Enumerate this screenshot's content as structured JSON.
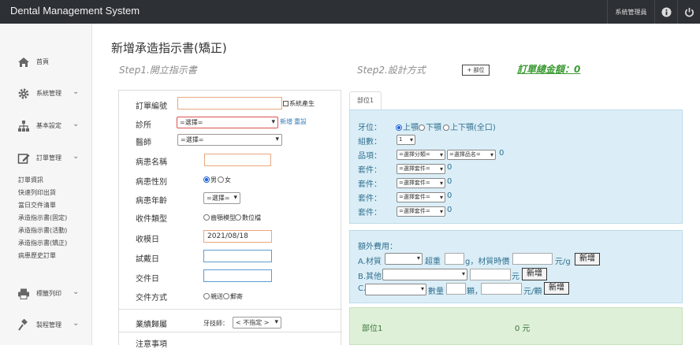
{
  "app": {
    "title": "Dental Management System",
    "user_label": "系統管理員"
  },
  "sidebar": {
    "items": [
      {
        "label": "首頁",
        "icon": "home-icon"
      },
      {
        "label": "系統管理",
        "icon": "gear-icon"
      },
      {
        "label": "基本設定",
        "icon": "sitemap-icon"
      },
      {
        "label": "訂單管理",
        "icon": "edit-icon"
      },
      {
        "label": "標籤列印",
        "icon": "print-icon"
      },
      {
        "label": "製程管理",
        "icon": "gavel-icon"
      }
    ],
    "sub_items": [
      "訂單資訊",
      "快速列印出貨",
      "當日交件清單",
      "承造指示書(固定)",
      "承造指示書(活動)",
      "承造指示書(矯正)",
      "病患歷史訂單"
    ]
  },
  "page": {
    "title": "新增承造指示書(矯正)",
    "step1": "Step1.開立指示書",
    "step2": "Step2.設計方式",
    "add_part_button": "+ 部位",
    "total_label": "訂單總金額：0"
  },
  "form": {
    "order_no": {
      "label": "訂單編號",
      "value": "",
      "checkbox_label": "系統產生"
    },
    "clinic": {
      "label": "診所",
      "value": "=選擇=",
      "link_add": "新增",
      "link_reset": "重設"
    },
    "doctor": {
      "label": "醫師",
      "value": "=選擇="
    },
    "patient_name": {
      "label": "病患名稱",
      "value": ""
    },
    "patient_gender": {
      "label": "病患性別",
      "options": [
        "男",
        "女"
      ],
      "selected": "男"
    },
    "patient_age": {
      "label": "病患年齡",
      "value": "=選擇="
    },
    "receive_type": {
      "label": "收件類型",
      "options": [
        "齒顎模型",
        "數位檔"
      ]
    },
    "receive_date": {
      "label": "收模日",
      "value": "2021/08/18"
    },
    "try_date": {
      "label": "試戴日",
      "value": ""
    },
    "delivery_date": {
      "label": "交件日",
      "value": ""
    },
    "delivery_method": {
      "label": "交件方式",
      "options": [
        "親送",
        "郵寄"
      ]
    },
    "business": {
      "label": "業績歸屬",
      "tech_label": "牙技師：",
      "tech_value": "< 不指定 >"
    },
    "notes": {
      "label": "注意事項"
    }
  },
  "design": {
    "tab_label": "部位1",
    "tooth_position": {
      "label": "牙位：",
      "options": [
        "上顎",
        "下顎",
        "上下顎(全口)"
      ],
      "selected": "上顎"
    },
    "group_count": {
      "label": "組數：",
      "value": "1"
    },
    "item": {
      "label": "品項：",
      "category": "=選擇分類=",
      "name": "=選擇品名=",
      "price": "0"
    },
    "sets": [
      {
        "label": "套件：",
        "value": "=選擇套件=",
        "price": "0"
      },
      {
        "label": "套件：",
        "value": "=選擇套件=",
        "price": "0"
      },
      {
        "label": "套件：",
        "value": "=選擇套件=",
        "price": "0"
      },
      {
        "label": "套件：",
        "value": "=選擇套件=",
        "price": "0"
      }
    ]
  },
  "extra": {
    "title": "額外費用：",
    "material": {
      "label": "A.材質",
      "weight_label": "超重",
      "unit_g": "g，材質時價",
      "unit_price": "元/g",
      "add": "新增"
    },
    "other": {
      "label": "B.其他",
      "unit": "元",
      "add": "新增"
    },
    "c": {
      "label": "C.",
      "qty_label": "數量",
      "qty_unit": "顆，",
      "unit": "元/顆",
      "add": "新增"
    }
  },
  "summary": {
    "part": "部位1",
    "amount": "0 元"
  }
}
